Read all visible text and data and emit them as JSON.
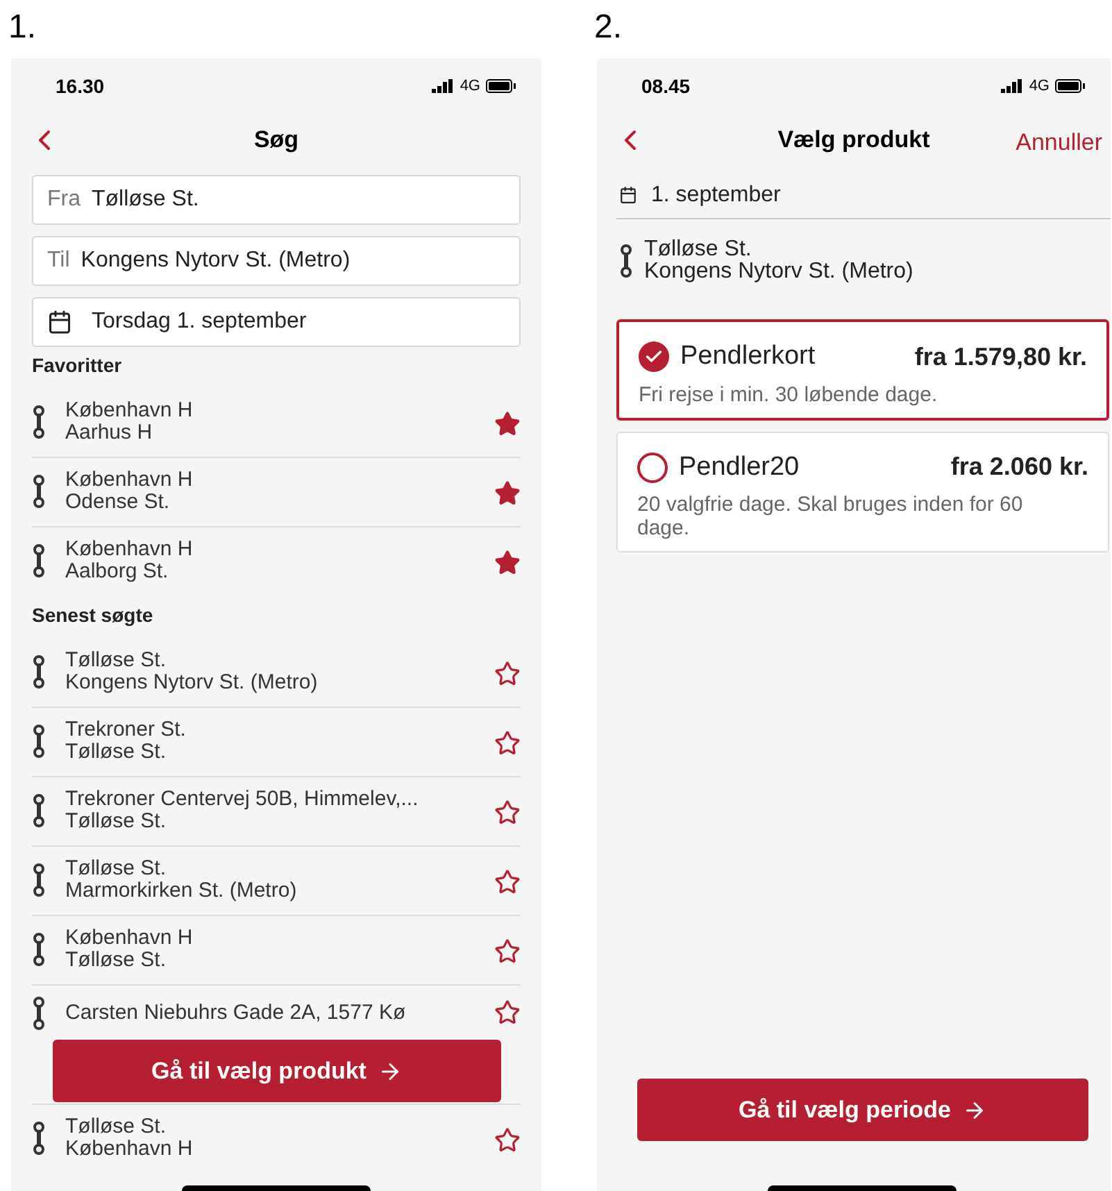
{
  "screens": [
    {
      "kind": "search",
      "label": "1.",
      "status_bar": {
        "time": "16.30",
        "network": "4G"
      },
      "header": {
        "title": "Søg"
      },
      "fields": [
        {
          "kind": "text",
          "label": "Fra",
          "value": "Tølløse St."
        },
        {
          "kind": "text",
          "label": "Til",
          "value": "Kongens Nytorv St. (Metro)"
        },
        {
          "kind": "date",
          "value": "Torsdag 1. september"
        }
      ],
      "sections": [
        {
          "title": "Favoritter",
          "items": [
            {
              "from": "København H",
              "to": "Aarhus H",
              "favorite": true
            },
            {
              "from": "København H",
              "to": "Odense St.",
              "favorite": true
            },
            {
              "from": "København H",
              "to": "Aalborg St.",
              "favorite": true
            }
          ]
        },
        {
          "title": "Senest søgte",
          "items": [
            {
              "from": "Tølløse St.",
              "to": "Kongens Nytorv St. (Metro)",
              "favorite": false
            },
            {
              "from": "Trekroner St.",
              "to": "Tølløse St.",
              "favorite": false
            },
            {
              "from": "Trekroner Centervej 50B, Himmelev,...",
              "to": "Tølløse St.",
              "favorite": false
            },
            {
              "from": "Tølløse St.",
              "to": "Marmorkirken St. (Metro)",
              "favorite": false
            },
            {
              "from": "København H",
              "to": "Tølløse St.",
              "favorite": false
            },
            {
              "from": "Carsten Niebuhrs Gade 2A, 1577 Kø",
              "favorite": false
            },
            {
              "from": "Tølløse St.",
              "to": "København H",
              "favorite": false
            }
          ]
        }
      ],
      "button": "Gå til vælg produkt"
    },
    {
      "kind": "product",
      "label": "2.",
      "status_bar": {
        "time": "08.45",
        "network": "4G"
      },
      "header": {
        "title": "Vælg produkt",
        "action": "Annuller"
      },
      "date": "1. september",
      "route": {
        "from": "Tølløse St.",
        "to": "Kongens Nytorv St. (Metro)"
      },
      "products": [
        {
          "name": "Pendlerkort",
          "price": "fra 1.579,80 kr.",
          "description": "Fri rejse i min. 30 løbende dage.",
          "selected": true
        },
        {
          "name": "Pendler20",
          "price": "fra 2.060 kr.",
          "description": "20 valgfrie dage. Skal bruges inden for 60 dage.",
          "selected": false
        }
      ],
      "button": "Gå til vælg periode"
    }
  ]
}
